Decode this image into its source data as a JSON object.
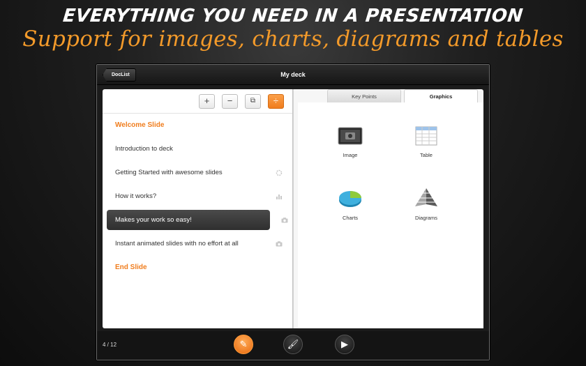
{
  "promo": {
    "headline": "EVERYTHING YOU NEED IN A PRESENTATION",
    "subline": "Support for images, charts, diagrams and tables"
  },
  "topbar": {
    "back_label": "DocList",
    "title": "My deck"
  },
  "toolbar": {
    "buttons": [
      {
        "icon": "plus-icon",
        "glyph": "+"
      },
      {
        "icon": "minus-icon",
        "glyph": "−"
      },
      {
        "icon": "duplicate-icon",
        "glyph": "⧉"
      },
      {
        "icon": "reorder-icon",
        "glyph": "÷",
        "active": true
      }
    ]
  },
  "slides": [
    {
      "label": "Welcome Slide",
      "style": "orange"
    },
    {
      "label": "Introduction to deck"
    },
    {
      "label": "Getting Started with awesome slides",
      "icon": "loading-icon"
    },
    {
      "label": "How it works?",
      "icon": "chart-icon"
    },
    {
      "label": "Makes your work so easy!",
      "icon": "camera-icon",
      "selected": true
    },
    {
      "label": "Instant animated slides with no effort at all",
      "icon": "camera-icon"
    },
    {
      "label": "End Slide",
      "style": "orange"
    }
  ],
  "tabs": {
    "key_points": "Key Points",
    "graphics": "Graphics"
  },
  "graphics": {
    "image": "Image",
    "table": "Table",
    "charts": "Charts",
    "diagrams": "Diagrams"
  },
  "footer": {
    "page_counter": "4 / 12"
  },
  "colors": {
    "accent": "#f07d1d",
    "selected_row": "#3a3a3a",
    "page_bg": "#ffffff"
  }
}
